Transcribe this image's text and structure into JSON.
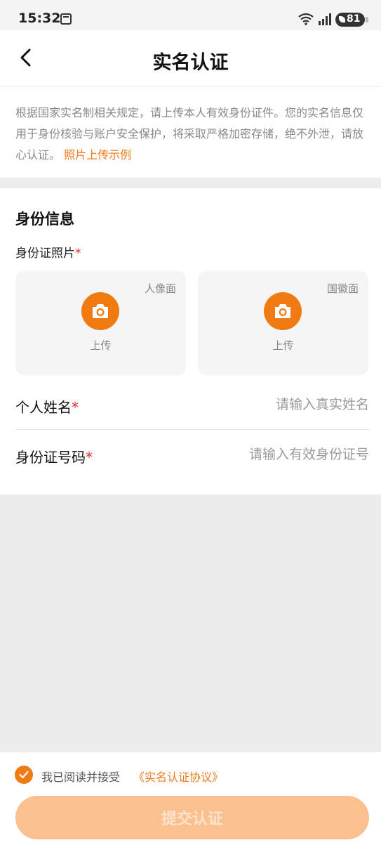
{
  "status_bar": {
    "time": "15:32",
    "battery": "81",
    "icons": [
      "calendar-icon",
      "wifi-icon",
      "signal-icon",
      "battery-icon"
    ]
  },
  "header": {
    "title": "实名认证",
    "back_icon": "chevron-left-icon"
  },
  "notice": {
    "text": "根据国家实名制相关规定，请上传本人有效身份证件。您的实名信息仅用于身份核验与账户安全保护，将采取严格加密存储，绝不外泄，请放心认证。",
    "link_label": "照片上传示例"
  },
  "form": {
    "section_title": "身份信息",
    "photo_label": "身份证照片",
    "required_mark": "*",
    "cards": [
      {
        "corner_label": "人像面",
        "upload_label": "上传",
        "icon": "camera-icon"
      },
      {
        "corner_label": "国徽面",
        "upload_label": "上传",
        "icon": "camera-icon"
      }
    ],
    "name_field": {
      "label": "个人姓名",
      "placeholder": "请输入真实姓名",
      "value": ""
    },
    "id_field": {
      "label": "身份证号码",
      "placeholder": "请输入有效身份证号",
      "value": ""
    }
  },
  "footer": {
    "agree_text": "我已阅读并接受",
    "agreement_link": "《实名认证协议》",
    "agree_checked": true,
    "submit_label": "提交认证"
  },
  "colors": {
    "accent": "#f07b12",
    "link": "#f07b1a",
    "submit_disabled": "#fbc08f",
    "required": "#e03030",
    "page_bg": "#ececec"
  }
}
